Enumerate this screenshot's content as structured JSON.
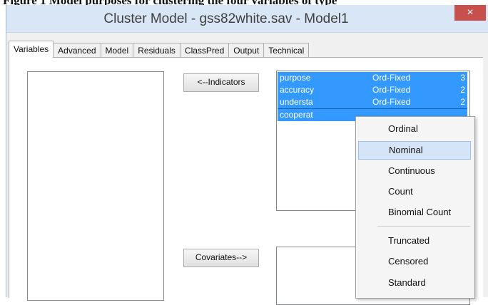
{
  "caption_partial": "Figure 1 Model purposes for clustering the four variables of type",
  "window": {
    "title": "Cluster Model - gss82white.sav - Model1",
    "close_glyph": "×"
  },
  "tabs": [
    {
      "label": "Variables",
      "active": true
    },
    {
      "label": "Advanced"
    },
    {
      "label": "Model"
    },
    {
      "label": "Residuals"
    },
    {
      "label": "ClassPred"
    },
    {
      "label": "Output"
    },
    {
      "label": "Technical"
    }
  ],
  "buttons": {
    "indicators": "<--Indicators",
    "covariates": "Covariates-->"
  },
  "indicators": [
    {
      "name": "purpose",
      "type": "Ord-Fixed",
      "count": "3"
    },
    {
      "name": "accuracy",
      "type": "Ord-Fixed",
      "count": "2"
    },
    {
      "name": "understa",
      "type": "Ord-Fixed",
      "count": "2"
    },
    {
      "name": "cooperat",
      "type": "",
      "count": ""
    }
  ],
  "context_menu": {
    "group1": [
      "Ordinal",
      "Nominal",
      "Continuous",
      "Count",
      "Binomial Count"
    ],
    "group2": [
      "Truncated",
      "Censored",
      "Standard"
    ],
    "highlighted": "Nominal"
  },
  "colors": {
    "selection": "#3399ff",
    "titlebar": "#d9e6f5",
    "close": "#c7504c",
    "menu_hover": "#d5e4f7"
  }
}
